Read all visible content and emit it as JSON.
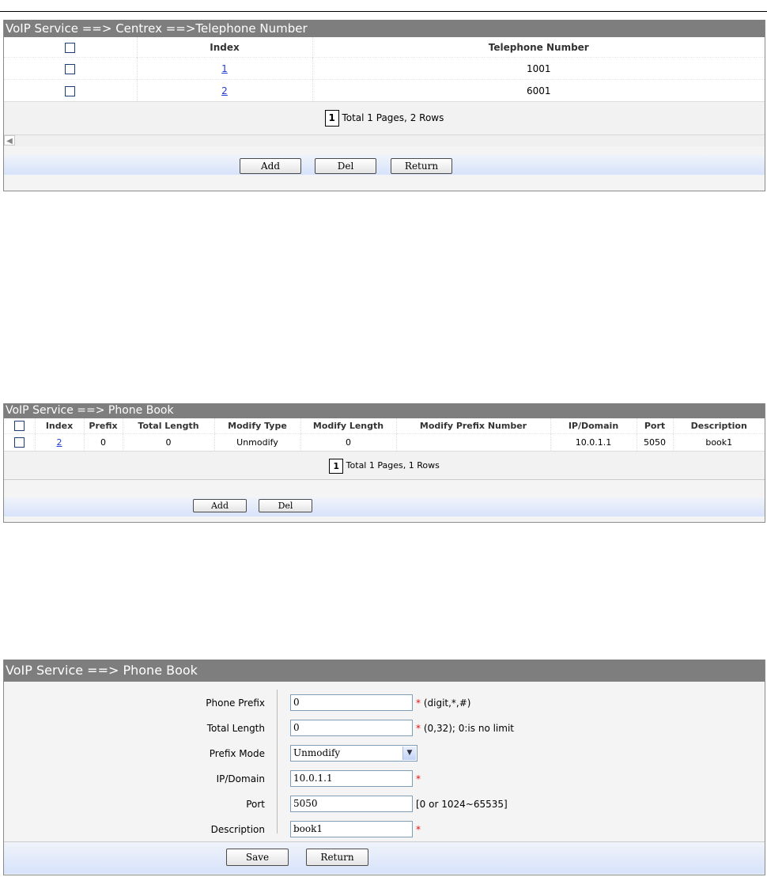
{
  "panel1": {
    "title": "VoIP Service ==> Centrex ==>Telephone Number",
    "columns": [
      "Index",
      "Telephone Number"
    ],
    "rows": [
      {
        "index": "1",
        "number": "1001"
      },
      {
        "index": "2",
        "number": "6001"
      }
    ],
    "pager": {
      "page": "1",
      "summary": "Total 1 Pages, 2 Rows"
    },
    "buttons": {
      "add": "Add",
      "del": "Del",
      "return": "Return"
    }
  },
  "panel2": {
    "title": "VoIP Service ==> Phone Book",
    "columns": [
      "Index",
      "Prefix",
      "Total Length",
      "Modify Type",
      "Modify Length",
      "Modify Prefix Number",
      "IP/Domain",
      "Port",
      "Description"
    ],
    "rows": [
      {
        "index": "2",
        "prefix": "0",
        "total_length": "0",
        "modify_type": "Unmodify",
        "modify_length": "0",
        "modify_prefix_number": "",
        "ip_domain": "10.0.1.1",
        "port": "5050",
        "description": "book1"
      }
    ],
    "pager": {
      "page": "1",
      "summary": "Total 1 Pages, 1 Rows"
    },
    "buttons": {
      "add": "Add",
      "del": "Del"
    }
  },
  "panel3": {
    "title": "VoIP Service ==> Phone Book",
    "fields": {
      "phone_prefix": {
        "label": "Phone Prefix",
        "value": "0",
        "required": "*",
        "hint": " (digit,*,#)"
      },
      "total_length": {
        "label": "Total Length",
        "value": "0",
        "required": "*",
        "hint": " (0,32); 0:is no limit"
      },
      "prefix_mode": {
        "label": "Prefix Mode",
        "value": "Unmodify"
      },
      "ip_domain": {
        "label": "IP/Domain",
        "value": "10.0.1.1",
        "required": "*"
      },
      "port": {
        "label": "Port",
        "value": "5050",
        "hint": "[0 or 1024~65535]"
      },
      "description": {
        "label": "Description",
        "value": "book1",
        "required": "*"
      }
    },
    "buttons": {
      "save": "Save",
      "return": "Return"
    }
  }
}
